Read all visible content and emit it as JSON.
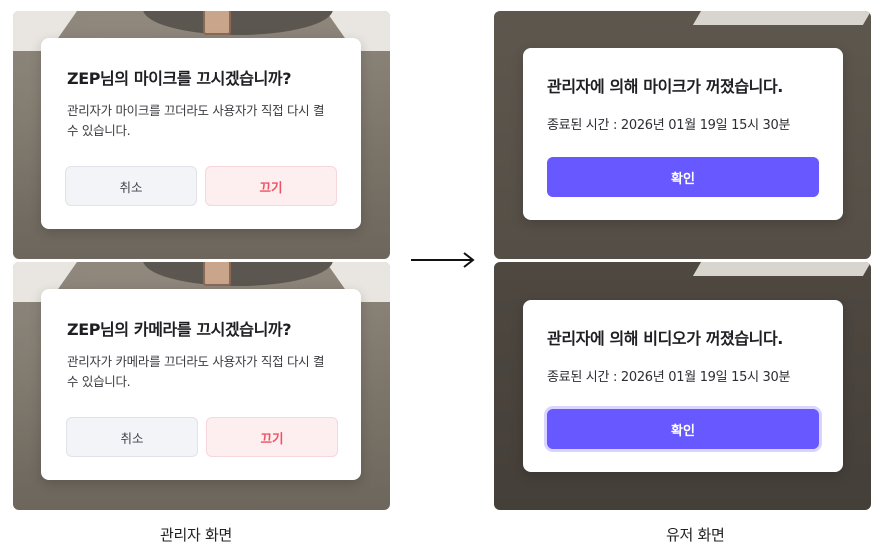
{
  "admin": {
    "mic_dialog": {
      "title": "ZEP님의 마이크를 끄시겠습니까?",
      "body": "관리자가 마이크를 끄더라도 사용자가 직접 다시 켤 수 있습니다.",
      "cancel_label": "취소",
      "off_label": "끄기"
    },
    "camera_dialog": {
      "title": "ZEP님의 카메라를 끄시겠습니까?",
      "body": "관리자가 카메라를 끄더라도 사용자가 직접 다시 켤 수 있습니다.",
      "cancel_label": "취소",
      "off_label": "끄기"
    },
    "caption": "관리자 화면"
  },
  "user": {
    "mic_dialog": {
      "title": "관리자에 의해 마이크가 꺼졌습니다.",
      "time_text": "종료된 시간 : 2026년 01월 19일 15시 30분",
      "confirm_label": "확인"
    },
    "video_dialog": {
      "title": "관리자에 의해 비디오가 꺼졌습니다.",
      "time_text": "종료된 시간 : 2026년 01월 19일 15시 30분",
      "confirm_label": "확인"
    },
    "caption": "유저 화면"
  },
  "icons": {
    "flow": "arrow-right-icon"
  },
  "colors": {
    "primary": "#6758ff",
    "danger_text": "#f05062",
    "danger_bg": "#fdeef0",
    "cancel_bg": "#f3f4f7"
  }
}
